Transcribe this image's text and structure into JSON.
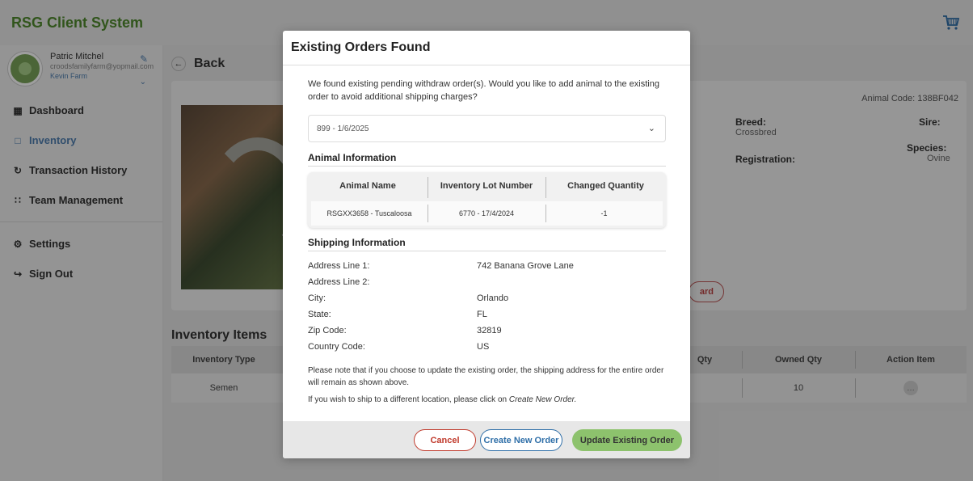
{
  "app": {
    "title": "RSG Client System"
  },
  "profile": {
    "name": "Patric Mitchel",
    "email": "croodsfamilyfarm@yopmail.com",
    "farm": "Kevin Farm"
  },
  "sidebar": {
    "items": [
      {
        "label": "Dashboard",
        "icon": "dashboard-icon"
      },
      {
        "label": "Inventory",
        "icon": "inventory-icon"
      },
      {
        "label": "Transaction History",
        "icon": "history-icon"
      },
      {
        "label": "Team Management",
        "icon": "team-icon"
      }
    ],
    "settings": "Settings",
    "sign_out": "Sign Out"
  },
  "main": {
    "back": "Back",
    "animal_code": "Animal Code: 138BF042",
    "breed_label": "Breed:",
    "breed_value": "Crossbred",
    "sire_label": "Sire:",
    "species_label": "Species:",
    "species_value": "Ovine",
    "registration_label": "Registration:",
    "discard_partial": "ard",
    "inventory_title": "Inventory Items",
    "inventory_headers": [
      "Inventory Type",
      "Qty",
      "Owned Qty",
      "Action Item"
    ],
    "inventory_row": {
      "type": "Semen",
      "owned_qty": "10",
      "action": "…"
    }
  },
  "modal": {
    "title": "Existing Orders Found",
    "intro": "We found existing pending withdraw order(s). Would you like to add animal to the existing order to avoid additional shipping charges?",
    "selected_order": "899 - 1/6/2025",
    "animal_section": "Animal Information",
    "animal_headers": [
      "Animal Name",
      "Inventory Lot Number",
      "Changed Quantity"
    ],
    "animal_row": [
      "RSGXX3658 - Tuscaloosa",
      "6770 - 17/4/2024",
      "-1"
    ],
    "shipping_section": "Shipping Information",
    "shipping": [
      {
        "k": "Address Line 1:",
        "v": "742 Banana Grove Lane"
      },
      {
        "k": "Address Line 2:",
        "v": ""
      },
      {
        "k": "City:",
        "v": "Orlando"
      },
      {
        "k": "State:",
        "v": "FL"
      },
      {
        "k": "Zip Code:",
        "v": "32819"
      },
      {
        "k": "Country Code:",
        "v": "US"
      }
    ],
    "note": "Please note that if you choose to update the existing order, the shipping address for the entire order will remain as shown above.",
    "note2_prefix": "If you wish to ship to a different location, please click on ",
    "note2_link": "Create New Order.",
    "buttons": {
      "cancel": "Cancel",
      "create_new": "Create New Order",
      "update": "Update Existing Order"
    }
  },
  "colors": {
    "brand_green": "#4f8a2e",
    "accent_blue": "#2f6fa8",
    "update_green": "#8dc26d",
    "cancel_red": "#c0392b"
  }
}
